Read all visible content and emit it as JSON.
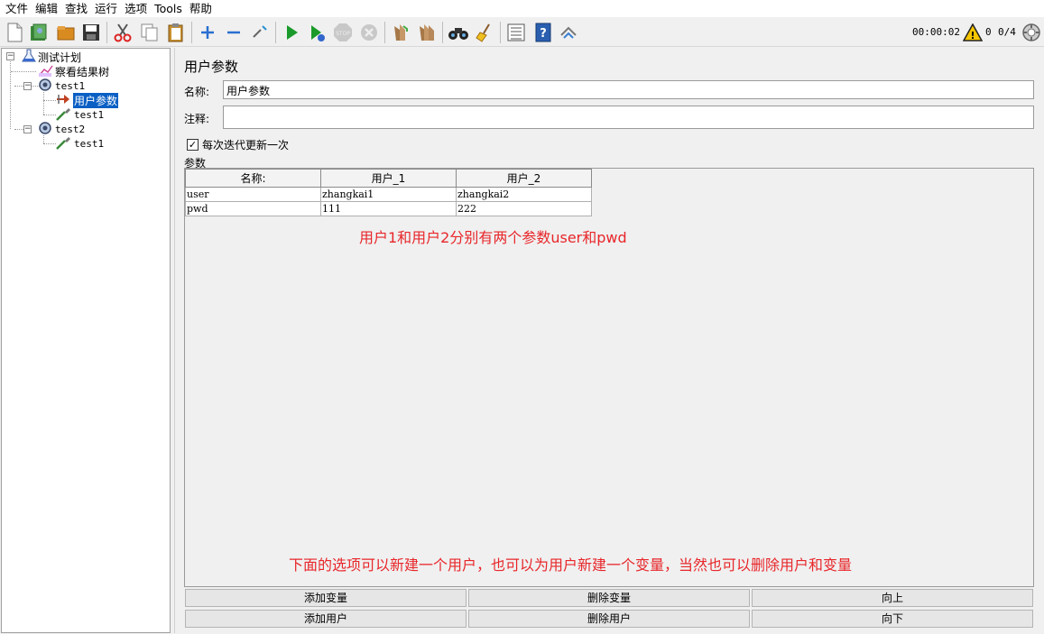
{
  "menu": [
    "文件",
    "编辑",
    "查找",
    "运行",
    "选项",
    "Tools",
    "帮助"
  ],
  "status": {
    "timer": "00:00:02",
    "warning_count": "0",
    "threads": "0/4"
  },
  "tree": {
    "root": "测试计划",
    "listener": "察看结果树",
    "group1": "test1",
    "user_params": "用户参数",
    "sampler1": "test1",
    "group2": "test2",
    "sampler2": "test1"
  },
  "panel": {
    "title": "用户参数",
    "name_label": "名称:",
    "name_value": "用户参数",
    "comment_label": "注释:",
    "comment_value": "",
    "checkbox_label": "每次迭代更新一次",
    "params_label": "参数"
  },
  "table": {
    "headers": [
      "名称:",
      "用户_1",
      "用户_2"
    ],
    "rows": [
      [
        "user",
        "zhangkai1",
        "zhangkai2"
      ],
      [
        "pwd",
        "111",
        "222"
      ]
    ]
  },
  "notes": {
    "top": "用户1和用户2分别有两个参数user和pwd",
    "bottom": "下面的选项可以新建一个用户，也可以为用户新建一个变量，当然也可以删除用户和变量"
  },
  "buttons": {
    "add_variable": "添加变量",
    "delete_variable": "删除变量",
    "move_up": "向上",
    "add_user": "添加用户",
    "delete_user": "删除用户",
    "move_down": "向下"
  }
}
